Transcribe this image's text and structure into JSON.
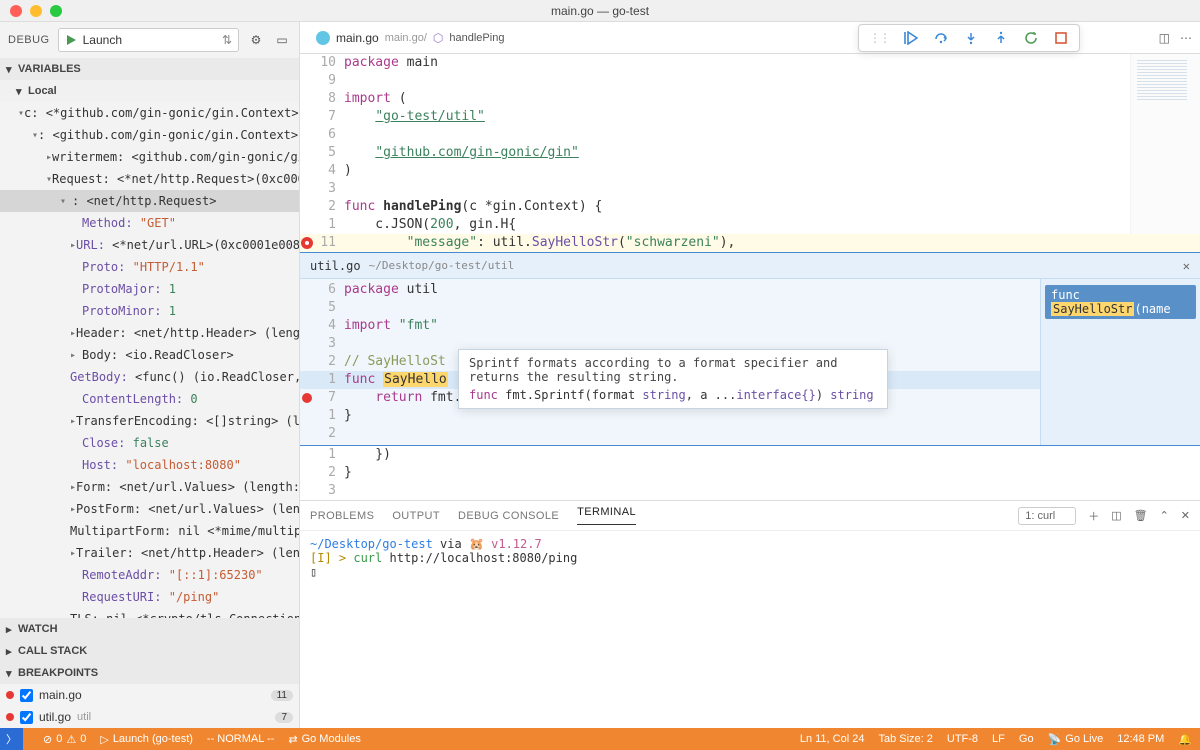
{
  "window": {
    "title": "main.go — go-test"
  },
  "debug": {
    "label": "DEBUG",
    "config": "Launch",
    "sections": {
      "variables": "VARIABLES",
      "local": "Local",
      "watch": "WATCH",
      "callstack": "CALL STACK",
      "breakpoints": "BREAKPOINTS"
    }
  },
  "vars": {
    "c_root": "c: <*github.com/gin-gonic/gin.Context>…",
    "c_inner": ": <github.com/gin-gonic/gin.Context>",
    "writermem": "writermem: <github.com/gin-gonic/gi…",
    "request": "Request: <*net/http.Request>(0xc000…",
    "req_inner": ": <net/http.Request>",
    "method_k": "Method:",
    "method_v": "\"GET\"",
    "url": "URL: <*net/url.URL>(0xc0001e0080)",
    "proto_k": "Proto:",
    "proto_v": "\"HTTP/1.1\"",
    "pmaj_k": "ProtoMajor:",
    "pmaj_v": "1",
    "pmin_k": "ProtoMinor:",
    "pmin_v": "1",
    "header": "Header: <net/http.Header> (length…",
    "body": "Body: <io.ReadCloser>",
    "getbody": "GetBody: <func() (io.ReadCloser, …",
    "clen_k": "ContentLength:",
    "clen_v": "0",
    "tenc": "TransferEncoding: <[]string> (len…",
    "close_k": "Close:",
    "close_v": "false",
    "host_k": "Host:",
    "host_v": "\"localhost:8080\"",
    "form": "Form: <net/url.Values> (length: 0)…",
    "postform": "PostForm: <net/url.Values> (lengt…",
    "multipart": "MultipartForm: nil <*mime/multipa…",
    "trailer": "Trailer: <net/http.Header> (lengt…",
    "raddr_k": "RemoteAddr:",
    "raddr_v": "\"[::1]:65230\"",
    "ruri_k": "RequestURI:",
    "ruri_v": "\"/ping\"",
    "tls": "TLS: nil <*crypto/tls.ConnectionS…"
  },
  "breakpoints": {
    "items": [
      {
        "file": "main.go",
        "count": "11"
      },
      {
        "file": "util.go",
        "sub": "util",
        "count": "7"
      }
    ]
  },
  "tabs": {
    "main": {
      "name": "main.go",
      "path": "main.go/",
      "crumb": "handlePing"
    }
  },
  "editor_main": {
    "lines": [
      {
        "n": "10",
        "t": "package main",
        "kw": [
          [
            0,
            7
          ]
        ]
      },
      {
        "n": "9",
        "t": ""
      },
      {
        "n": "8",
        "t": "import (",
        "kw": [
          [
            0,
            6
          ]
        ]
      },
      {
        "n": "7",
        "t": "    \"go-test/util\""
      },
      {
        "n": "6",
        "t": ""
      },
      {
        "n": "5",
        "t": "    \"github.com/gin-gonic/gin\""
      },
      {
        "n": "4",
        "t": ")"
      },
      {
        "n": "3",
        "t": ""
      },
      {
        "n": "2",
        "t": "func handlePing(c *gin.Context) {"
      },
      {
        "n": "1",
        "t": "    c.JSON(200, gin.H{"
      },
      {
        "n": "11",
        "t": "        \"message\": util.SayHelloStr(\"schwarzeni\"),",
        "hl": true,
        "bp": true
      },
      {
        "after_peek": true,
        "n": "1",
        "t": "    })"
      },
      {
        "n": "2",
        "t": "}"
      },
      {
        "n": "3",
        "t": ""
      }
    ]
  },
  "peek": {
    "file": "util.go",
    "path": "~/Desktop/go-test/util",
    "side_label_pre": "func ",
    "side_label_hl": "SayHelloStr",
    "side_label_post": "(name",
    "lines": [
      {
        "n": "6",
        "t": "package util"
      },
      {
        "n": "5",
        "t": ""
      },
      {
        "n": "4",
        "t": "import \"fmt\""
      },
      {
        "n": "3",
        "t": ""
      },
      {
        "n": "2",
        "t": "// SayHelloSt"
      },
      {
        "n": "1",
        "t": "func SayHello",
        "selhi": true
      },
      {
        "n": "7",
        "t": "    return fmt.Sprintf(\"Hello %s\\n\", name)",
        "bp": true
      },
      {
        "n": "1",
        "t": "}"
      },
      {
        "n": "2",
        "t": ""
      }
    ]
  },
  "hover": {
    "doc": "Sprintf formats according to a format specifier and returns the resulting string.",
    "sig_pre": "func fmt.Sprintf(format ",
    "sig_t1": "string",
    "sig_mid": ", a ...",
    "sig_t2": "interface{}",
    "sig_post": ") ",
    "sig_ret": "string"
  },
  "panel": {
    "tabs": {
      "problems": "PROBLEMS",
      "output": "OUTPUT",
      "debug": "DEBUG CONSOLE",
      "terminal": "TERMINAL"
    },
    "term_select": "1: curl",
    "term": {
      "l1_a": "~/Desktop/go-test",
      "l1_b": " via ",
      "l1_c": "🐹 v1.12.7",
      "l2_a": "[I] > ",
      "l2_b": "curl",
      "l2_c": " http://localhost:8080/ping",
      "l3": "▯"
    }
  },
  "status": {
    "err": "0",
    "warn": "0",
    "launch": "Launch (go-test)",
    "mode": "-- NORMAL --",
    "modules": "Go Modules",
    "ln": "Ln 11, Col 24",
    "tab": "Tab Size: 2",
    "enc": "UTF-8",
    "eol": "LF",
    "lang": "Go",
    "live": "Go Live",
    "time": "12:48 PM"
  }
}
